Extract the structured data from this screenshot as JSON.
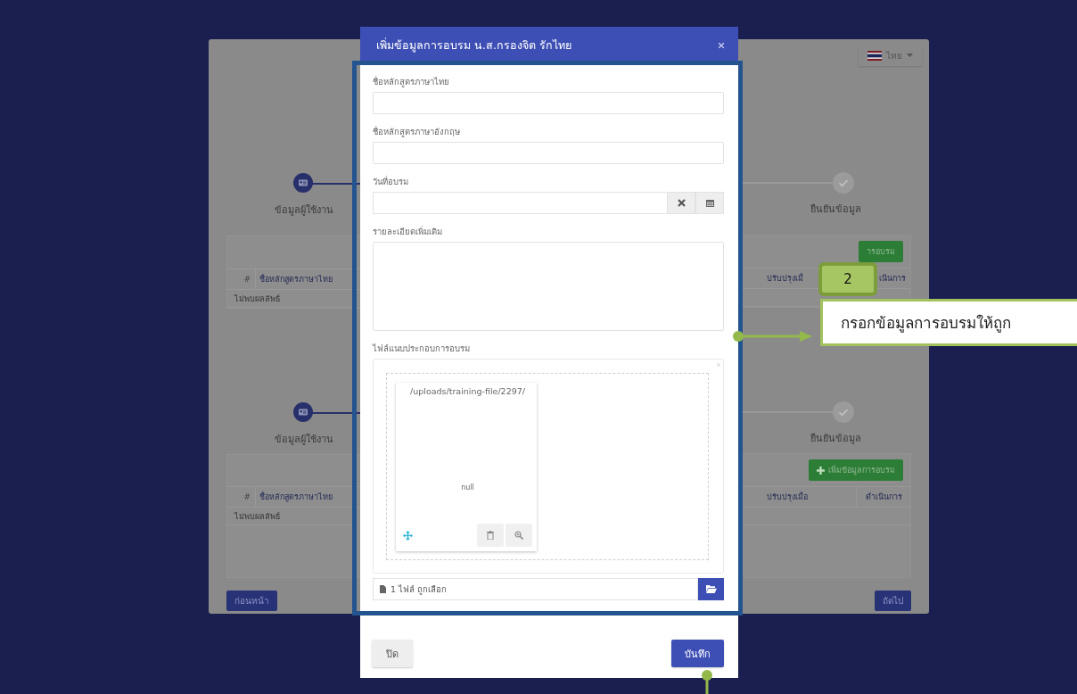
{
  "background_page": {
    "language": "ไทย",
    "sections": [
      {
        "step_left": "ข้อมูลผู้ใช้งาน",
        "step_right": "ยืนยันข้อมูล",
        "add_button": "ารอบรม",
        "columns_left": [
          "#",
          "ชื่อหลักสูตรภาษาไทย"
        ],
        "columns_right": [
          "ปรับปรุงเมื่",
          "เนินการ"
        ],
        "empty_row": "ไม่พบผลลัพธ์"
      },
      {
        "step_left": "ข้อมูลผู้ใช้งาน",
        "step_right": "ยืนยันข้อมูล",
        "add_button": "เพิ่มข้อมูลการอบรม",
        "columns_left": [
          "#",
          "ชื่อหลักสูตรภาษาไทย"
        ],
        "columns_right": [
          "ปรับปรุงเมื่อ",
          "ดำเนินการ"
        ],
        "empty_row": "ไม่พบผลลัพธ์"
      }
    ],
    "prev_button": "ก่อนหน้า",
    "next_button": "ถัดไป"
  },
  "modal": {
    "title": "เพิ่มข้อมูลการอบรม น.ส.กรองจิต รักไทย",
    "fields": [
      {
        "kind": "text",
        "label": "ชื่อหลักสูตรภาษาไทย"
      },
      {
        "kind": "text",
        "label": "ชื่อหลักสูตรภาษาอังกฤษ"
      },
      {
        "kind": "date",
        "label": "วันที่อบรม"
      },
      {
        "kind": "textarea",
        "label": "รายละเอียดเพิ่มเติม"
      },
      {
        "kind": "file",
        "label": "ไฟล์แนบประกอบการอบรม",
        "file_path": "/uploads/training-file/2297/",
        "preview_caption": "null",
        "caption": "1 ไฟล์ ถูกเลือก"
      }
    ],
    "close_button": "ปิด",
    "save_button": "บันทึก"
  },
  "callout": {
    "badge": "2",
    "text": "กรอกข้อมูลการอบรมให้ถูก"
  }
}
